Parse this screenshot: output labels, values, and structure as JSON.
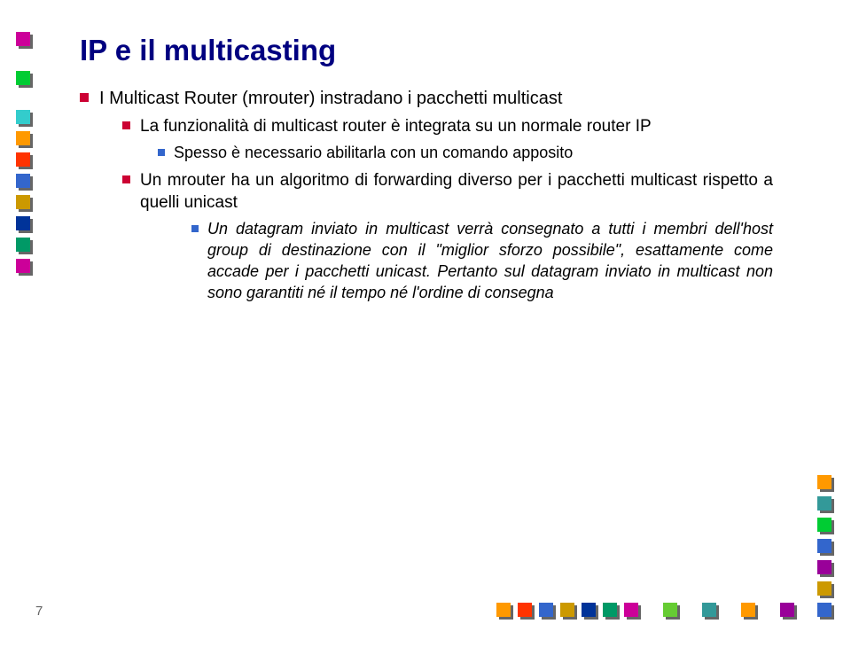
{
  "title": "IP e il multicasting",
  "b1": "I Multicast Router (mrouter) instradano i pacchetti multicast",
  "b2": "La funzionalità di multicast router è integrata su un normale router IP",
  "b3": "Spesso è necessario abilitarla con un comando apposito",
  "b4": "Un mrouter ha un algoritmo di forwarding diverso per i pacchetti multicast rispetto a quelli unicast",
  "b5a": "Un datagram inviato in multicast verrà consegnato a tutti i membri dell'host group di destinazione con il \"miglior sforzo possibile\", esattamente come accade per i pacchetti unicast.",
  "b5b": "Pertanto sul datagram inviato in multicast non sono garantiti né il tempo né l'ordine di consegna",
  "page_number": "7",
  "deco_colors": {
    "magenta": "#cc0099",
    "green": "#00cc33",
    "cyan": "#33cccc",
    "orange": "#ff9900",
    "red": "#ff3300",
    "blue": "#3366cc",
    "gold": "#cc9900",
    "navy": "#003399",
    "purple": "#990099",
    "teal": "#339999",
    "lime": "#66cc33",
    "forest": "#009966"
  }
}
